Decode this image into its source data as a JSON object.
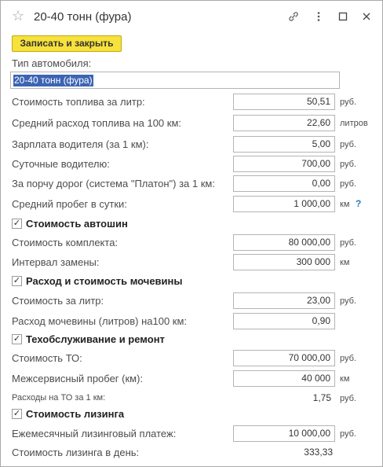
{
  "window": {
    "title": "20-40 тонн (фура)"
  },
  "toolbar": {
    "save_close": "Записать и закрыть"
  },
  "icons": {
    "star": "star-icon",
    "link": "link-icon",
    "more": "more-vertical-icon",
    "maximize": "maximize-icon",
    "close": "close-icon"
  },
  "vehicle_type": {
    "label": "Тип автомобиля:",
    "value": "20-40 тонн (фура)"
  },
  "fuel_price": {
    "label": "Стоимость топлива за литр:",
    "value": "50,51",
    "unit": "руб."
  },
  "fuel_consumption": {
    "label": "Средний расход топлива на 100 км:",
    "value": "22,60",
    "unit": "литров"
  },
  "driver_salary": {
    "label": "Зарплата водителя (за 1 км):",
    "value": "5,00",
    "unit": "руб."
  },
  "driver_daily": {
    "label": "Суточные водителю:",
    "value": "700,00",
    "unit": "руб."
  },
  "road_damage": {
    "label": "За порчу дорог (система \"Платон\") за 1 км:",
    "value": "0,00",
    "unit": "руб."
  },
  "daily_mileage": {
    "label": "Средний пробег в сутки:",
    "value": "1 000,00",
    "unit": "км",
    "help": "?"
  },
  "tires": {
    "title": "Стоимость автошин",
    "checked": true,
    "kit_cost": {
      "label": "Стоимость комплекта:",
      "value": "80 000,00",
      "unit": "руб."
    },
    "interval": {
      "label": "Интервал замены:",
      "value": "300 000",
      "unit": "км"
    }
  },
  "urea": {
    "title": "Расход и стоимость мочевины",
    "checked": true,
    "price": {
      "label": "Стоимость за литр:",
      "value": "23,00",
      "unit": "руб."
    },
    "consumption": {
      "label": "Расход мочевины (литров) на100 км:",
      "value": "0,90"
    }
  },
  "service": {
    "title": "Техобслуживание и ремонт",
    "checked": true,
    "cost": {
      "label": "Стоимость ТО:",
      "value": "70 000,00",
      "unit": "руб."
    },
    "interval": {
      "label": "Межсервисный пробег (км):",
      "value": "40 000",
      "unit": "км"
    },
    "per_km": {
      "label": "Расходы на ТО за 1 км:",
      "value": "1,75",
      "unit": "руб."
    }
  },
  "leasing": {
    "title": "Стоимость лизинга",
    "checked": true,
    "monthly": {
      "label": "Ежемесячный лизинговый платеж:",
      "value": "10 000,00",
      "unit": "руб."
    },
    "daily": {
      "label": "Стоимость лизинга в день:",
      "value": "333,33"
    }
  }
}
